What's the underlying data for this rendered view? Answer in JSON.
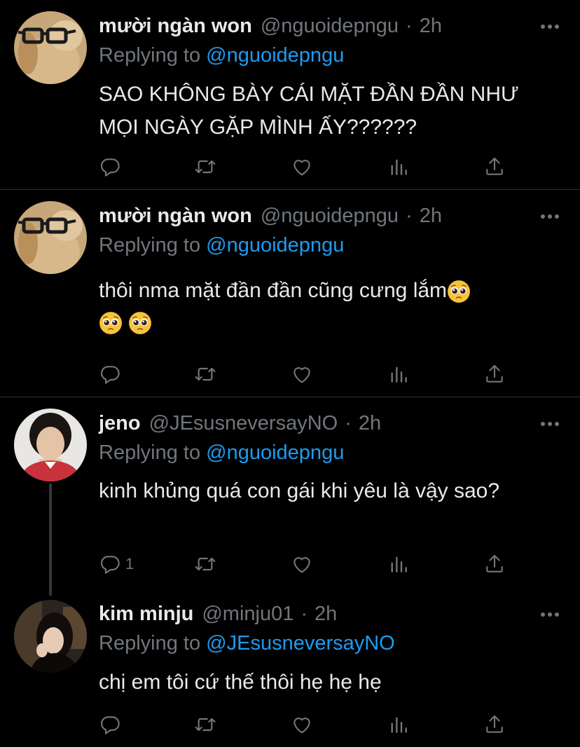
{
  "tweets": [
    {
      "name": "mười ngàn won",
      "handle": "@nguoidepngu",
      "time": "2h",
      "replying_prefix": "Replying to",
      "replying_to": "@nguoidepngu",
      "text": "SAO KHÔNG BÀY CÁI MẶT ĐẦN ĐẦN NHƯ MỌI NGÀY GẶP MÌNH ẤY??????",
      "reply_count": "",
      "avatar_icon": "rabbit-with-glasses"
    },
    {
      "name": "mười ngàn won",
      "handle": "@nguoidepngu",
      "time": "2h",
      "replying_prefix": "Replying to",
      "replying_to": "@nguoidepngu",
      "text": "thôi nma mặt đần đần cũng cưng lắm",
      "emoji_name": "pleading-face-emoji",
      "reply_count": "",
      "avatar_icon": "rabbit-with-glasses"
    },
    {
      "name": "jeno",
      "handle": "@JEsusneversayNO",
      "time": "2h",
      "replying_prefix": "Replying to",
      "replying_to": "@nguoidepngu",
      "text": "kinh khủng quá con gái khi yêu là vậy sao?",
      "reply_count": "1",
      "avatar_icon": "boy-portrait"
    },
    {
      "name": "kim minju",
      "handle": "@minju01",
      "time": "2h",
      "replying_prefix": "Replying to",
      "replying_to": "@JEsusneversayNO",
      "text": "chị em tôi cứ thế thôi hẹ hẹ hẹ",
      "reply_count": "",
      "avatar_icon": "girl-portrait"
    }
  ],
  "separator": "·",
  "colors": {
    "background": "#000000",
    "text": "#e7e9ea",
    "muted": "#71767b",
    "link": "#1d9bf0",
    "divider": "#2f3336"
  }
}
